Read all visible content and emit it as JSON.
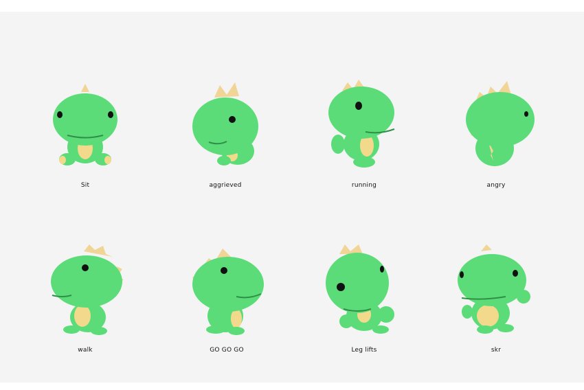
{
  "characters": [
    {
      "label": "Sit"
    },
    {
      "label": "aggrieved"
    },
    {
      "label": "running"
    },
    {
      "label": "angry"
    },
    {
      "label": "walk"
    },
    {
      "label": "GO GO GO"
    },
    {
      "label": "Leg lifts"
    },
    {
      "label": "skr"
    }
  ],
  "colors": {
    "body_green": "#5bdc78",
    "belly_yellow": "#f3d98c",
    "spike_yellow": "#f0d596",
    "eye": "#111111",
    "background": "#f4f4f4"
  }
}
